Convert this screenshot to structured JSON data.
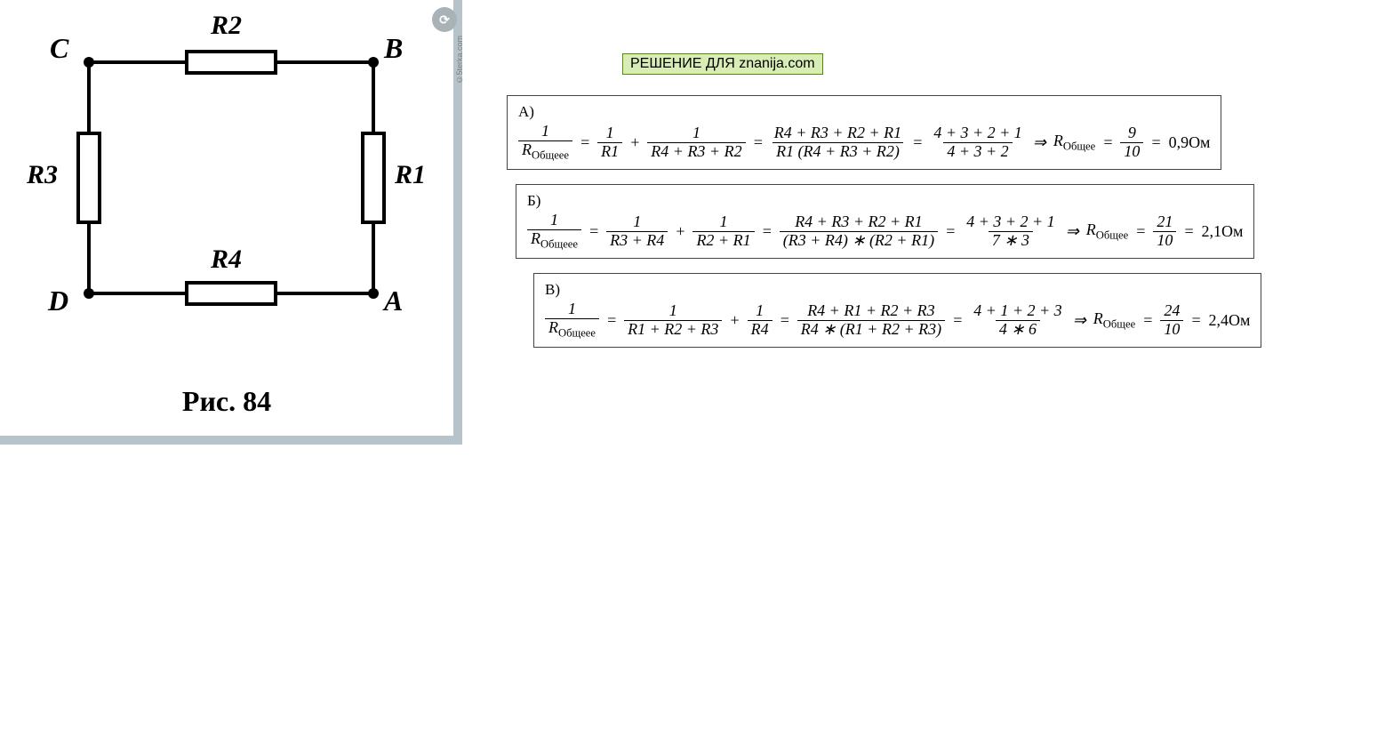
{
  "left": {
    "caption": "Рис. 84",
    "watermark_text": "©5terka.com",
    "nodes": {
      "C": "C",
      "B": "B",
      "D": "D",
      "A": "A"
    },
    "resistors": {
      "R1": "R1",
      "R2": "R2",
      "R3": "R3",
      "R4": "R4"
    }
  },
  "solution_label": "РЕШЕНИЕ ДЛЯ znanija.com",
  "equations": {
    "A": {
      "letter": "А)",
      "lhs_num": "1",
      "lhs_den": "R",
      "lhs_sub": "Общеее",
      "t1_num": "1",
      "t1_den": "R1",
      "t2_num": "1",
      "t2_den": "R4 + R3 + R2",
      "sym_num": "R4 + R3 + R2 + R1",
      "sym_den": "R1 (R4 + R3 + R2)",
      "num_expr_top": "4 + 3 + 2 + 1",
      "num_expr_bot": "4 + 3 + 2",
      "res_label": "R",
      "res_sub": "Общее",
      "frac_top": "9",
      "frac_bot": "10",
      "answer": "0,9Ом"
    },
    "B": {
      "letter": "Б)",
      "lhs_num": "1",
      "lhs_den": "R",
      "lhs_sub": "Общеее",
      "t1_num": "1",
      "t1_den": "R3 + R4",
      "t2_num": "1",
      "t2_den": "R2 + R1",
      "sym_num": "R4 + R3 + R2 + R1",
      "sym_den": "(R3 + R4) ∗ (R2 + R1)",
      "num_expr_top": "4 + 3 + 2 + 1",
      "num_expr_bot": "7 ∗ 3",
      "res_label": "R",
      "res_sub": "Общее",
      "frac_top": "21",
      "frac_bot": "10",
      "answer": "2,1Ом"
    },
    "C": {
      "letter": "В)",
      "lhs_num": "1",
      "lhs_den": "R",
      "lhs_sub": "Общеее",
      "t1_num": "1",
      "t1_den": "R1 + R2 + R3",
      "t2_num": "1",
      "t2_den": "R4",
      "sym_num": "R4 + R1 + R2 + R3",
      "sym_den": "R4 ∗ (R1 + R2 + R3)",
      "num_expr_top": "4 + 1 + 2 + 3",
      "num_expr_bot": "4 ∗ 6",
      "res_label": "R",
      "res_sub": "Общее",
      "frac_top": "24",
      "frac_bot": "10",
      "answer": "2,4Ом"
    }
  }
}
